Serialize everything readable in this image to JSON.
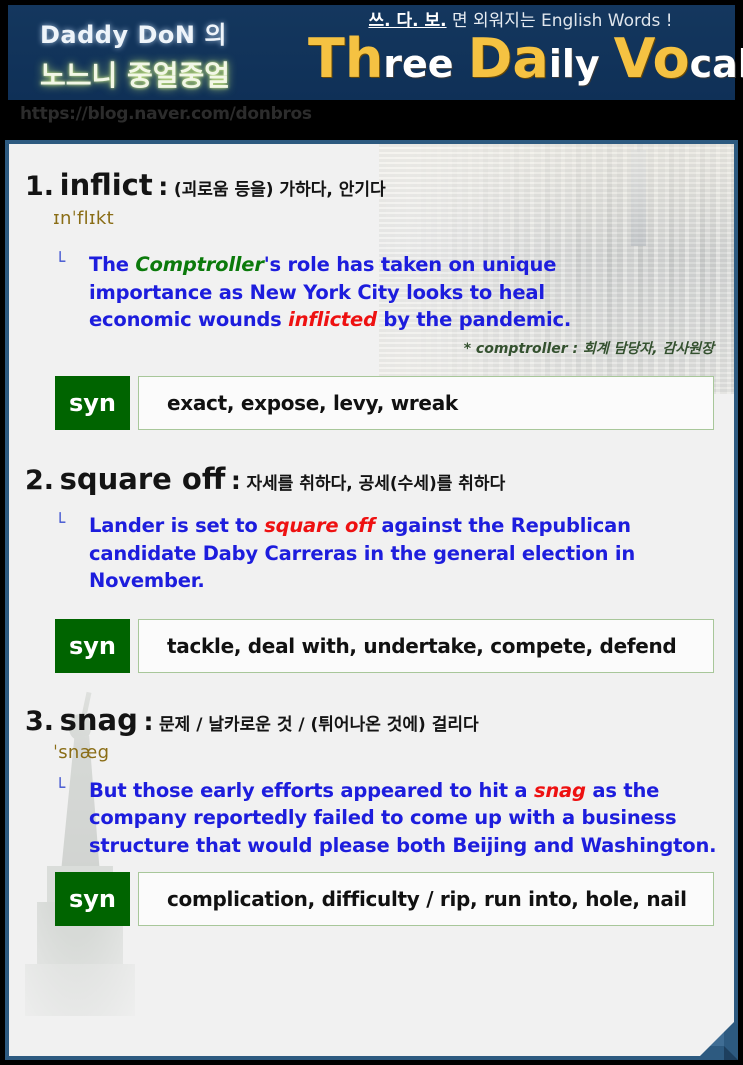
{
  "header": {
    "brand_line1": "Daddy DoN 의",
    "brand_line2": "노느니 중얼중얼",
    "tagline_korean_bold": "쓰. 다. 보.",
    "tagline_korean": " 면 외워지는 ",
    "tagline_english": "English Words !",
    "title_parts": [
      {
        "text": "Th",
        "style": "yellow"
      },
      {
        "text": "ree",
        "style": "white"
      },
      {
        "text": "Da",
        "style": "yellow"
      },
      {
        "text": "ily",
        "style": "white"
      },
      {
        "text": "Vo",
        "style": "yellow"
      },
      {
        "text": "cabs",
        "style": "white"
      }
    ],
    "url": "https://blog.naver.com/donbros",
    "band_color": "#113359",
    "accent_yellow": "#f5c242"
  },
  "entries": [
    {
      "number": "1.",
      "word": "inflict",
      "colon": ":",
      "meaning": "(괴로움 등을) 가하다, 안기다",
      "pronunciation": "ɪnˈflɪkt",
      "bullet": "└",
      "example_pre": "The ",
      "example_green": "Comptroller",
      "example_mid": "'s role has taken on unique importance as New York City looks to heal economic wounds ",
      "example_highlight": "inflicted",
      "example_post": " by the pandemic.",
      "footnote": "* comptroller : 회계 담당자, 감사원장",
      "syn_label": "syn",
      "syn_text": "exact, expose, levy, wreak"
    },
    {
      "number": "2.",
      "word": "square off",
      "colon": ":",
      "meaning": "자세를 취하다, 공세(수세)를 취하다",
      "pronunciation": "",
      "bullet": "└",
      "example_pre": "Lander is set to ",
      "example_green": "",
      "example_mid": "",
      "example_highlight": "square off",
      "example_post": " against the Republican candidate Daby Carreras in the general election in November.",
      "footnote": "",
      "syn_label": "syn",
      "syn_text": "tackle, deal with, undertake, compete, defend"
    },
    {
      "number": "3.",
      "word": "snag",
      "colon": ":",
      "meaning": "문제 / 날카로운 것 / (튀어나온 것에) 걸리다",
      "pronunciation": "ˈsnæg",
      "bullet": "└",
      "example_pre": "But those early efforts appeared to hit a ",
      "example_green": "",
      "example_mid": "",
      "example_highlight": "snag",
      "example_post": " as the company reportedly failed to come up with a business structure that would please both Beijing and Washington.",
      "footnote": "",
      "syn_label": "syn",
      "syn_text": "complication, difficulty / rip, run into, hole, nail"
    }
  ],
  "colors": {
    "frame": "#2d5a80",
    "card_bg": "#f1f1f1",
    "syn_green": "#006400",
    "example_blue": "#1d1ddd",
    "highlight_red": "#ee1111",
    "phonetic_gold": "#8a6d16",
    "footnote_green": "#34512f"
  }
}
